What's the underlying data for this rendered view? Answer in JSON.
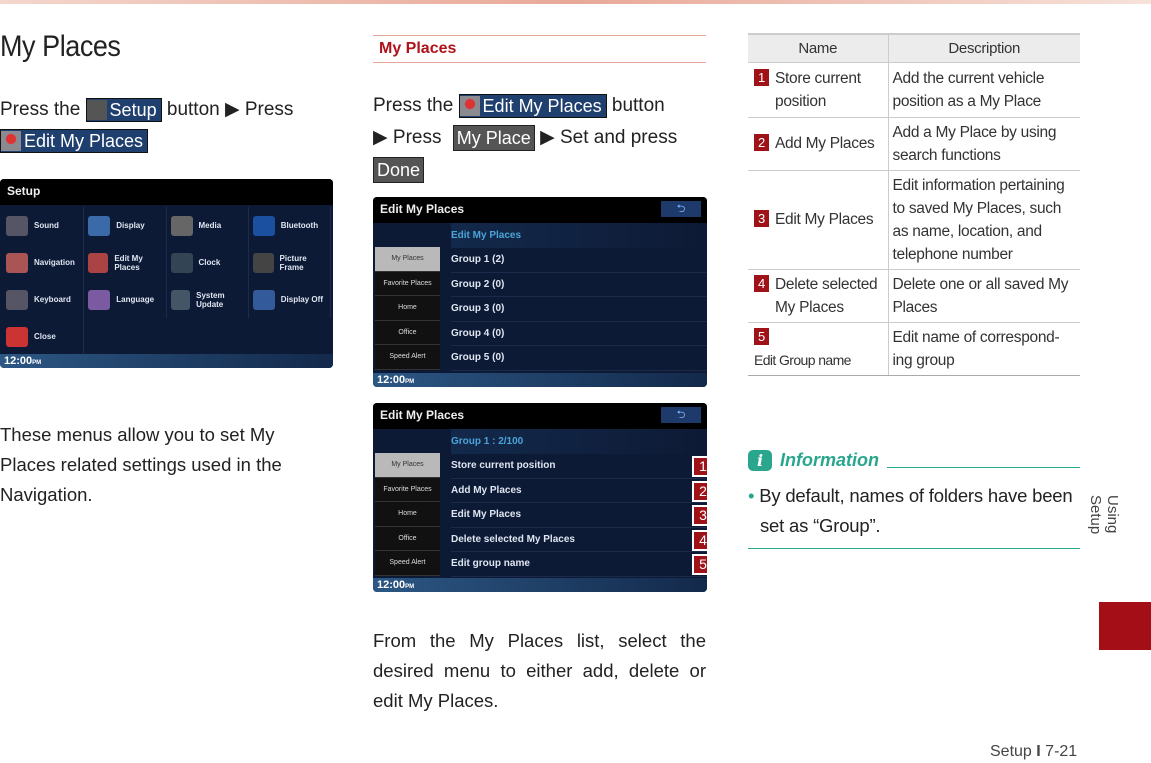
{
  "page_title": "My Places",
  "left": {
    "instr": {
      "p1": "Press the",
      "setup_btn": "Setup",
      "p2": "button ▶ Press",
      "edit_btn": "Edit My Places"
    },
    "setup_screen": {
      "title": "Setup",
      "items": [
        "Sound",
        "Display",
        "Media",
        "Bluetooth",
        "Navigation",
        "Edit My Places",
        "Clock",
        "Picture Frame",
        "Keyboard",
        "Language",
        "System Update",
        "Display Off",
        "Close"
      ],
      "time": "12:00",
      "ampm": "PM"
    },
    "desc": "These menus allow you to set My Places related settings used in the Navigation."
  },
  "middle": {
    "section_title": "My Places",
    "instr": {
      "p1": "Press the",
      "edit_btn": "Edit My Places",
      "p2": "button",
      "p3": "▶ Press",
      "myplace_btn": "My Place",
      "p4": "▶ Set and press",
      "done_btn": "Done"
    },
    "screen1": {
      "title": "Edit My Places",
      "back": "⮌",
      "side": [
        "My Places",
        "Favorite Places",
        "Home",
        "Office",
        "Speed Alert"
      ],
      "header": "Edit My Places",
      "rows": [
        "Group 1 (2)",
        "Group 2 (0)",
        "Group 3 (0)",
        "Group 4 (0)",
        "Group 5 (0)"
      ],
      "time": "12:00",
      "ampm": "PM"
    },
    "screen2": {
      "title": "Edit My Places",
      "back": "⮌",
      "side": [
        "My Places",
        "Favorite Places",
        "Home",
        "Office",
        "Speed Alert"
      ],
      "header": "Group 1 : 2/100",
      "rows": [
        "Store current position",
        "Add My Places",
        "Edit My Places",
        "Delete selected My Places",
        "Edit group name"
      ],
      "nums": [
        "1",
        "2",
        "3",
        "4",
        "5"
      ],
      "time": "12:00",
      "ampm": "PM"
    },
    "desc": "From the My Places list, select the desired menu to either add, delete or edit My Places."
  },
  "table": {
    "headers": [
      "Name",
      "Description"
    ],
    "rows": [
      {
        "num": "1",
        "name": "Store current position",
        "desc": "Add the current vehicle position as a My Place"
      },
      {
        "num": "2",
        "name": "Add My Places",
        "desc": "Add a My Place by using search functions"
      },
      {
        "num": "3",
        "name": "Edit My Places",
        "desc": "Edit information pertaining to saved My Places, such as name, location, and telephone number"
      },
      {
        "num": "4",
        "name": "Delete selected My Places",
        "desc": "Delete one or all saved My Places"
      },
      {
        "num": "5",
        "name": "Edit Group name",
        "desc": "Edit name of correspond-ing group"
      }
    ]
  },
  "info": {
    "title": "Information",
    "icon": "i",
    "bullet": "By default, names of folders have been set as “Group”."
  },
  "side_tab": "Using Setup",
  "footer": {
    "section": "Setup",
    "sep": "I",
    "page": "7-21"
  },
  "colors": {
    "accent_red": "#a30e17",
    "teal": "#2aa68e",
    "button_blue": "#1f3f6e"
  }
}
